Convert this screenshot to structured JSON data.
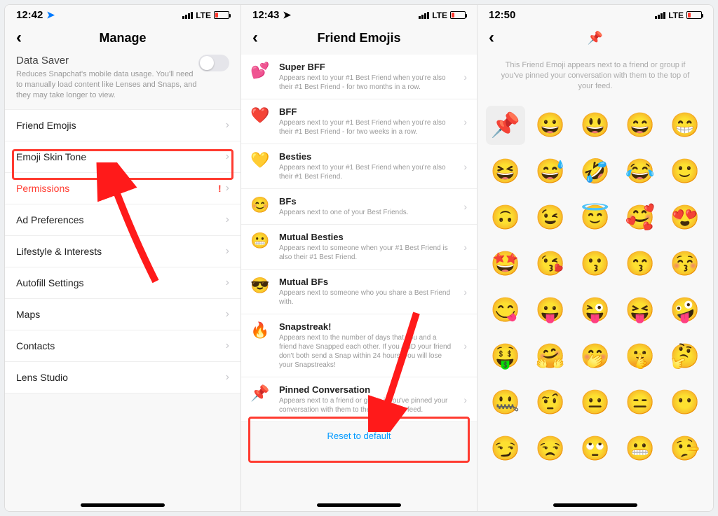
{
  "status": {
    "time1": "12:42",
    "time2": "12:43",
    "time3": "12:50",
    "network": "LTE"
  },
  "screen1": {
    "nav_title": "Manage",
    "data_saver_title": "Data Saver",
    "data_saver_desc": "Reduces Snapchat's mobile data usage. You'll need to manually load content like Lenses and Snaps, and they may take longer to view.",
    "rows": [
      {
        "label": "Friend Emojis",
        "red": false,
        "warn": false
      },
      {
        "label": "Emoji Skin Tone",
        "red": false,
        "warn": false
      },
      {
        "label": "Permissions",
        "red": true,
        "warn": true
      },
      {
        "label": "Ad Preferences",
        "red": false,
        "warn": false
      },
      {
        "label": "Lifestyle & Interests",
        "red": false,
        "warn": false
      },
      {
        "label": "Autofill Settings",
        "red": false,
        "warn": false
      },
      {
        "label": "Maps",
        "red": false,
        "warn": false
      },
      {
        "label": "Contacts",
        "red": false,
        "warn": false
      },
      {
        "label": "Lens Studio",
        "red": false,
        "warn": false
      }
    ]
  },
  "screen2": {
    "nav_title": "Friend Emojis",
    "rows": [
      {
        "emoji": "💕",
        "title": "Super BFF",
        "desc": "Appears next to your #1 Best Friend when you're also their #1 Best Friend - for two months in a row."
      },
      {
        "emoji": "❤️",
        "title": "BFF",
        "desc": "Appears next to your #1 Best Friend when you're also their #1 Best Friend - for two weeks in a row."
      },
      {
        "emoji": "💛",
        "title": "Besties",
        "desc": "Appears next to your #1 Best Friend when you're also their #1 Best Friend."
      },
      {
        "emoji": "😊",
        "title": "BFs",
        "desc": "Appears next to one of your Best Friends."
      },
      {
        "emoji": "😬",
        "title": "Mutual Besties",
        "desc": "Appears next to someone when your #1 Best Friend is also their #1 Best Friend."
      },
      {
        "emoji": "😎",
        "title": "Mutual BFs",
        "desc": "Appears next to someone who you share a Best Friend with."
      },
      {
        "emoji": "🔥",
        "title": "Snapstreak!",
        "desc": "Appears next to the number of days that you and a friend have Snapped each other. If you AND your friend don't both send a Snap within 24 hours, you will lose your Snapstreaks!"
      },
      {
        "emoji": "📌",
        "title": "Pinned Conversation",
        "desc": "Appears next to a friend or group if you've pinned your conversation with them to the top of your feed."
      }
    ],
    "reset_label": "Reset to default"
  },
  "screen3": {
    "nav_emoji": "📌",
    "desc": "This Friend Emoji appears next to a friend or group if you've pinned your conversation with them to the top of your feed.",
    "grid": [
      [
        "📌",
        "😀",
        "😃",
        "😄",
        "😁"
      ],
      [
        "😆",
        "😅",
        "🤣",
        "😂",
        "🙂"
      ],
      [
        "🙃",
        "😉",
        "😇",
        "🥰",
        "😍"
      ],
      [
        "🤩",
        "😘",
        "😗",
        "😙",
        "😚"
      ],
      [
        "😋",
        "😛",
        "😜",
        "😝",
        "🤪"
      ],
      [
        "🤑",
        "🤗",
        "🤭",
        "🤫",
        "🤔"
      ],
      [
        "🤐",
        "🤨",
        "😐",
        "😑",
        "😶"
      ],
      [
        "😏",
        "😒",
        "🙄",
        "😬",
        "🤥"
      ]
    ]
  }
}
